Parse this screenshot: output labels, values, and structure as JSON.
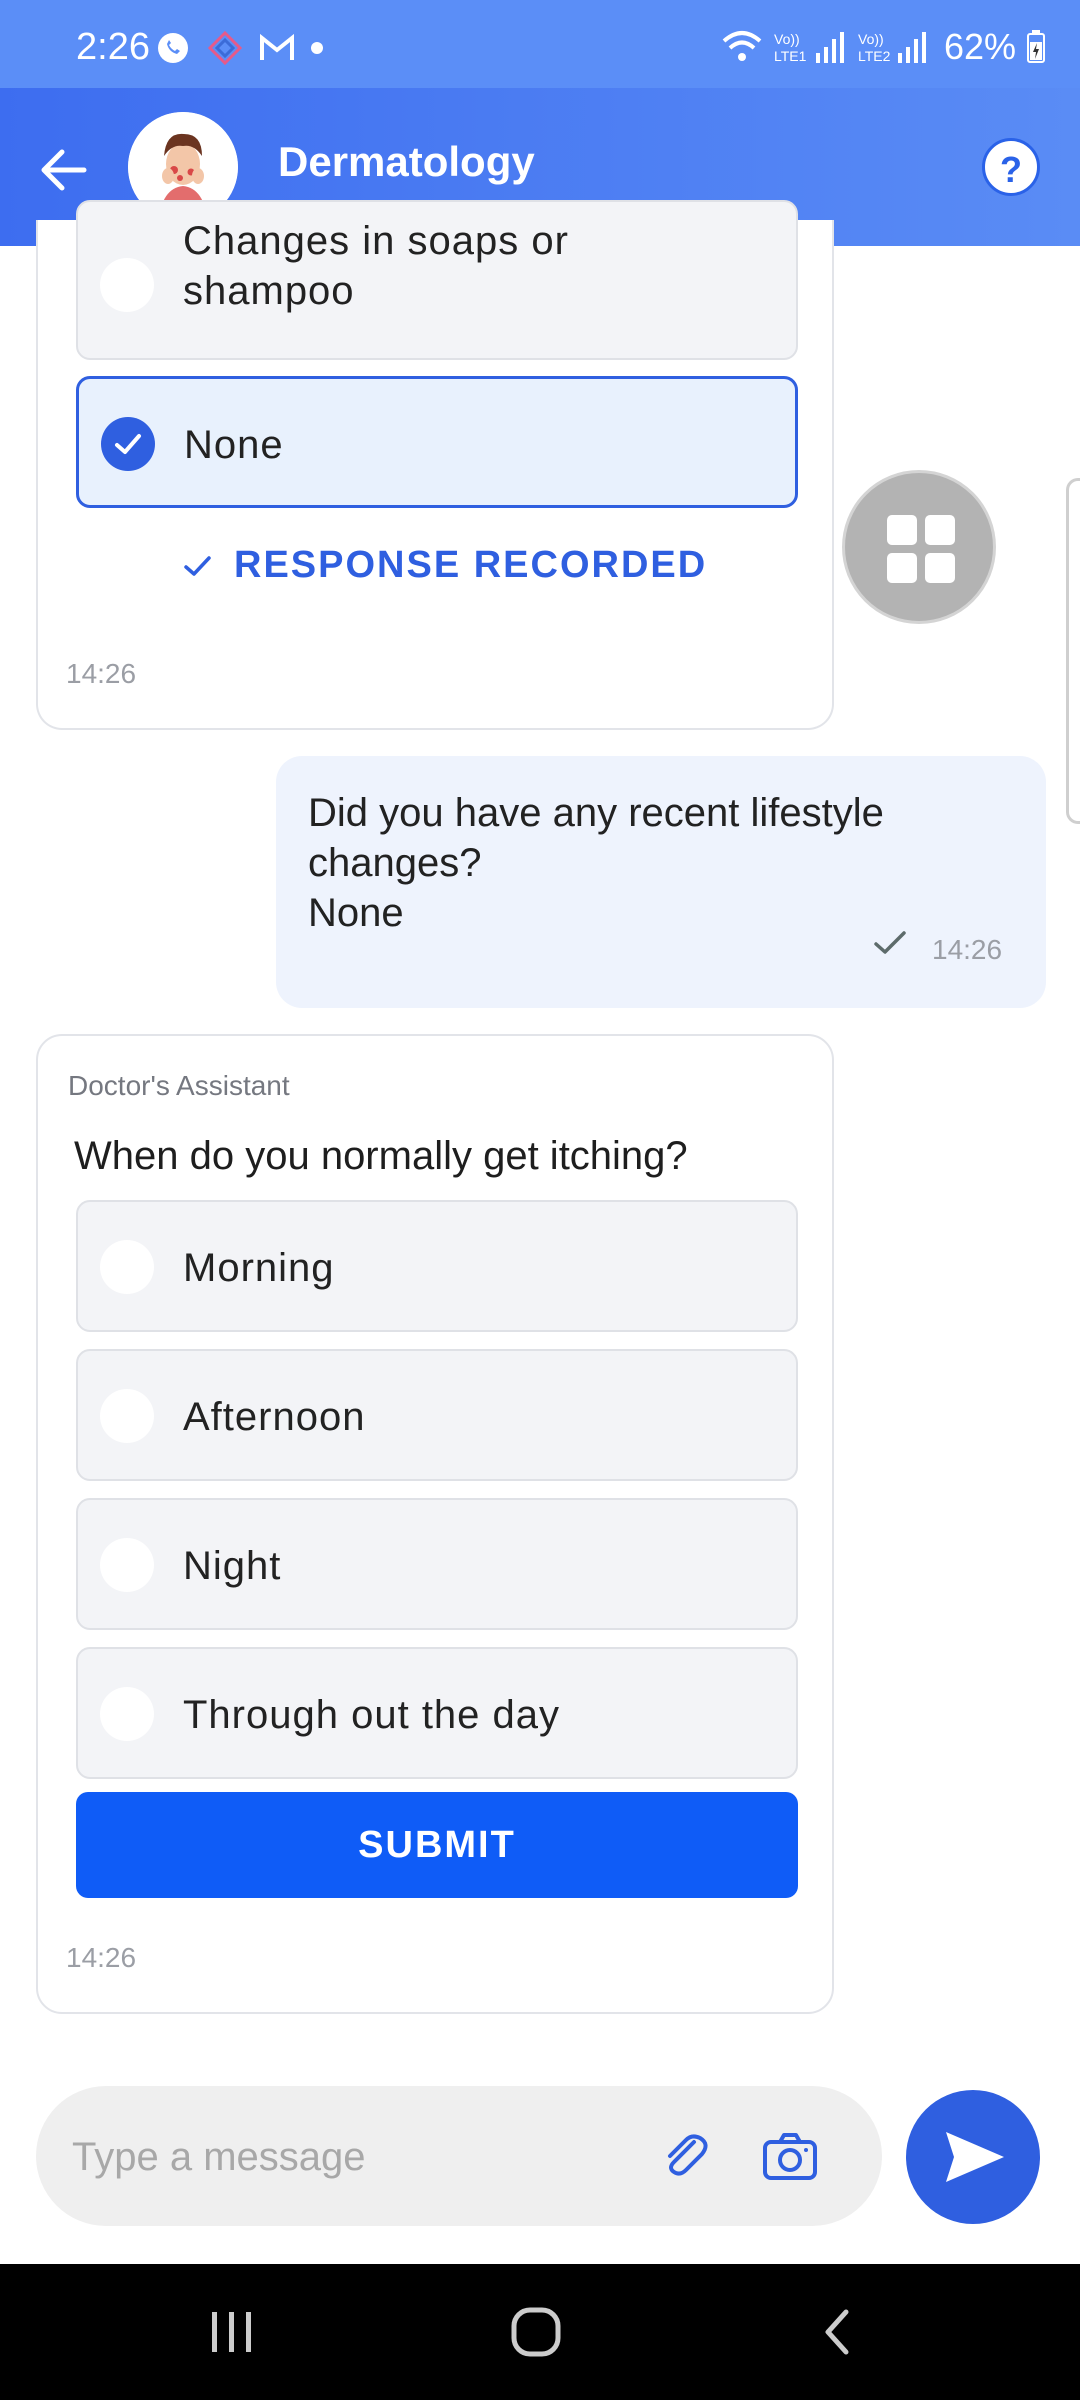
{
  "status_bar": {
    "time": "2:26",
    "signal_text": "Vo)) LTE1 R .ıll Vo)) LTE2 .ıll",
    "battery": "62%"
  },
  "header": {
    "title": "Dermatology",
    "help_label": "?"
  },
  "previous_question": {
    "options": [
      {
        "label": "Changes in soaps or shampoo",
        "selected": false
      },
      {
        "label": "None",
        "selected": true
      }
    ],
    "recorded_label": "RESPONSE RECORDED",
    "timestamp": "14:26"
  },
  "user_reply": {
    "text_line1": "Did you have any recent lifestyle changes?",
    "text_line2": "None",
    "timestamp": "14:26"
  },
  "current_question": {
    "sender": "Doctor's Assistant",
    "question": "When do you normally get itching?",
    "options": [
      {
        "label": "Morning"
      },
      {
        "label": "Afternoon"
      },
      {
        "label": "Night"
      },
      {
        "label": "Through out the day"
      }
    ],
    "submit_label": "SUBMIT",
    "timestamp": "14:26"
  },
  "composer": {
    "placeholder": "Type a message"
  },
  "colors": {
    "accent": "#2f5fe0",
    "submit": "#0f5cf7",
    "header": "#4a7bf2"
  }
}
